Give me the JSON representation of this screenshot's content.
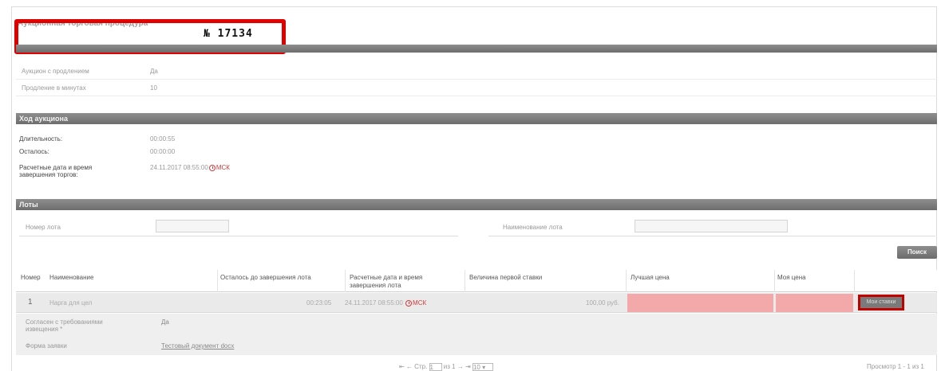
{
  "header": {
    "procedure_title": "Аукционная торговая процедура",
    "number": "№ 17134"
  },
  "auction_params": {
    "rows": [
      {
        "label": "Аукцион с продлением",
        "value": "Да"
      },
      {
        "label": "Продление в минутах",
        "value": "10"
      }
    ]
  },
  "progress": {
    "title": "Ход аукциона",
    "duration_label": "Длительность:",
    "duration_value": "00:00:55",
    "remaining_label": "Осталось:",
    "remaining_value": "00:00:00",
    "end_label_line1": "Расчетные дата и время",
    "end_label_line2": "завершения торгов:",
    "end_value": "24.11.2017 08:55:00",
    "tz": "МСК"
  },
  "lots": {
    "title": "Лоты",
    "lot_number_label": "Номер лота",
    "lot_name_label": "Наименование лота",
    "search_button": "Поиск",
    "columns": {
      "number": "Номер",
      "name": "Наименование",
      "remaining": "Осталось до завершения лота",
      "end_line1": "Расчетные дата и время",
      "end_line2": "завершения лота",
      "first_bid": "Величина первой ставки",
      "best_price": "Лучшая цена",
      "my_price": "Моя цена"
    },
    "row": {
      "number": "1",
      "name": "Нарга для цел",
      "remaining": "00:23:05",
      "end": "24.11.2017 08:55:00",
      "tz": "МСК",
      "first_bid": "100,00 руб.",
      "bid_button": "Мои ставки"
    },
    "details": {
      "agree_label_line1": "Согласен с требованиями",
      "agree_label_line2": "извещения *",
      "agree_value": "Да",
      "form_label": "Форма заявки",
      "form_link": "Тестовый документ docx"
    },
    "pager": {
      "page_label": "Стр.",
      "page_value": "1",
      "of_label": "из 1",
      "per_page": "10",
      "summary": "Просмотр 1 - 1 из 1"
    }
  },
  "colors": {
    "highlight_red": "#e00000",
    "best_price_fill": "#f3a9a9",
    "section_bar": "#7a7a7a"
  }
}
